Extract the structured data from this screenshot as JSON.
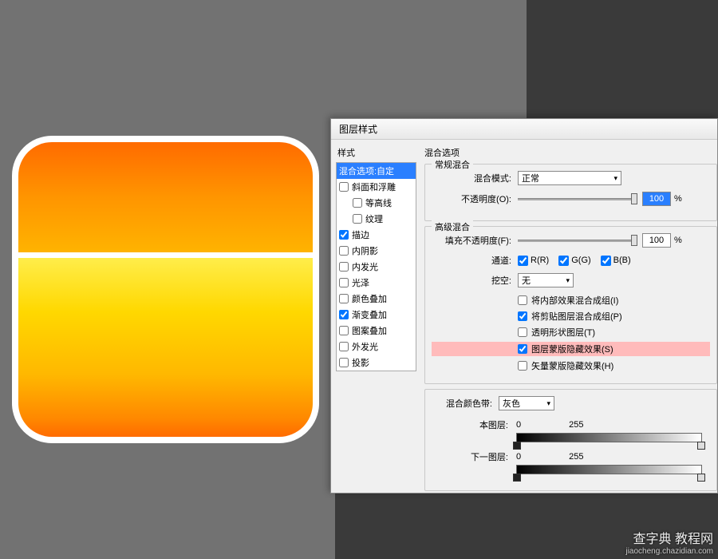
{
  "dialog": {
    "title": "图层样式",
    "styles_header": "样式",
    "styles_list": [
      {
        "label": "混合选项:自定",
        "checked": null,
        "selected": true,
        "indent": false
      },
      {
        "label": "斜面和浮雕",
        "checked": false,
        "selected": false,
        "indent": false
      },
      {
        "label": "等高线",
        "checked": false,
        "selected": false,
        "indent": true
      },
      {
        "label": "纹理",
        "checked": false,
        "selected": false,
        "indent": true
      },
      {
        "label": "描边",
        "checked": true,
        "selected": false,
        "indent": false
      },
      {
        "label": "内阴影",
        "checked": false,
        "selected": false,
        "indent": false
      },
      {
        "label": "内发光",
        "checked": false,
        "selected": false,
        "indent": false
      },
      {
        "label": "光泽",
        "checked": false,
        "selected": false,
        "indent": false
      },
      {
        "label": "颜色叠加",
        "checked": false,
        "selected": false,
        "indent": false
      },
      {
        "label": "渐变叠加",
        "checked": true,
        "selected": false,
        "indent": false
      },
      {
        "label": "图案叠加",
        "checked": false,
        "selected": false,
        "indent": false
      },
      {
        "label": "外发光",
        "checked": false,
        "selected": false,
        "indent": false
      },
      {
        "label": "投影",
        "checked": false,
        "selected": false,
        "indent": false
      }
    ]
  },
  "blending": {
    "section": "混合选项",
    "general": {
      "title": "常规混合",
      "mode_label": "混合模式:",
      "mode_value": "正常",
      "opacity_label": "不透明度(O):",
      "opacity_value": "100",
      "opacity_unit": "%"
    },
    "advanced": {
      "title": "高级混合",
      "fill_label": "填充不透明度(F):",
      "fill_value": "100",
      "fill_unit": "%",
      "channels_label": "通道:",
      "channels": {
        "r": "R(R)",
        "g": "G(G)",
        "b": "B(B)"
      },
      "knockout_label": "挖空:",
      "knockout_value": "无",
      "opts": [
        {
          "label": "将内部效果混合成组(I)",
          "checked": false,
          "hl": false
        },
        {
          "label": "将剪贴图层混合成组(P)",
          "checked": true,
          "hl": false
        },
        {
          "label": "透明形状图层(T)",
          "checked": false,
          "hl": false
        },
        {
          "label": "图层蒙版隐藏效果(S)",
          "checked": true,
          "hl": true
        },
        {
          "label": "矢量蒙版隐藏效果(H)",
          "checked": false,
          "hl": false
        }
      ]
    },
    "blendif": {
      "label": "混合颜色带:",
      "value": "灰色",
      "this_label": "本图层:",
      "this_lo": "0",
      "this_hi": "255",
      "under_label": "下一图层:",
      "under_lo": "0",
      "under_hi": "255"
    }
  },
  "watermark": {
    "main": "查字典 教程网",
    "sub": "jiaocheng.chazidian.com"
  }
}
